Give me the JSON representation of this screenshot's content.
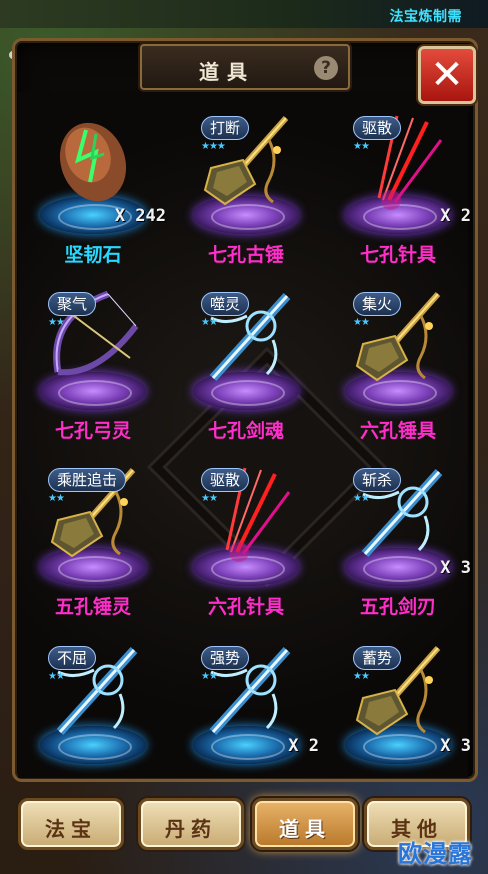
{
  "top_bar": {
    "title": "法宝炼制需"
  },
  "header": {
    "title": "道具",
    "help_label": "?",
    "close_label": "✕"
  },
  "items": [
    {
      "name": "坚韧石",
      "name_color": "cyan",
      "tag": "",
      "stars": 0,
      "count": "X 242",
      "pedestal": "blue",
      "art": "stone"
    },
    {
      "name": "七孔古锤",
      "name_color": "pink",
      "tag": "打断",
      "stars": 3,
      "count": "",
      "pedestal": "purple",
      "art": "hammer"
    },
    {
      "name": "七孔针具",
      "name_color": "pink",
      "tag": "驱散",
      "stars": 2,
      "count": "X 2",
      "pedestal": "purple",
      "art": "needles"
    },
    {
      "name": "七孔弓灵",
      "name_color": "pink",
      "tag": "聚气",
      "stars": 2,
      "count": "",
      "pedestal": "purple",
      "art": "bow"
    },
    {
      "name": "七孔剑魂",
      "name_color": "pink",
      "tag": "噬灵",
      "stars": 2,
      "count": "",
      "pedestal": "purple",
      "art": "sword"
    },
    {
      "name": "六孔锤具",
      "name_color": "pink",
      "tag": "集火",
      "stars": 2,
      "count": "",
      "pedestal": "purple",
      "art": "hammer"
    },
    {
      "name": "五孔锤灵",
      "name_color": "pink",
      "tag": "乘胜追击",
      "stars": 2,
      "count": "",
      "pedestal": "purple",
      "art": "hammer"
    },
    {
      "name": "六孔针具",
      "name_color": "pink",
      "tag": "驱散",
      "stars": 2,
      "count": "",
      "pedestal": "purple",
      "art": "needles"
    },
    {
      "name": "五孔剑刃",
      "name_color": "pink",
      "tag": "斩杀",
      "stars": 2,
      "count": "X 3",
      "pedestal": "purple",
      "art": "sword"
    },
    {
      "name": "",
      "name_color": "pink",
      "tag": "不屈",
      "stars": 2,
      "count": "",
      "pedestal": "blue",
      "art": "sword"
    },
    {
      "name": "",
      "name_color": "pink",
      "tag": "强势",
      "stars": 2,
      "count": "X 2",
      "pedestal": "blue",
      "art": "sword"
    },
    {
      "name": "",
      "name_color": "pink",
      "tag": "蓄势",
      "stars": 2,
      "count": "X 3",
      "pedestal": "blue",
      "art": "hammer"
    }
  ],
  "tabs": [
    {
      "label": "法宝",
      "active": false
    },
    {
      "label": "丹药",
      "active": false
    },
    {
      "label": "道具",
      "active": true
    },
    {
      "label": "其他",
      "active": false
    }
  ],
  "watermark": "欧漫露"
}
